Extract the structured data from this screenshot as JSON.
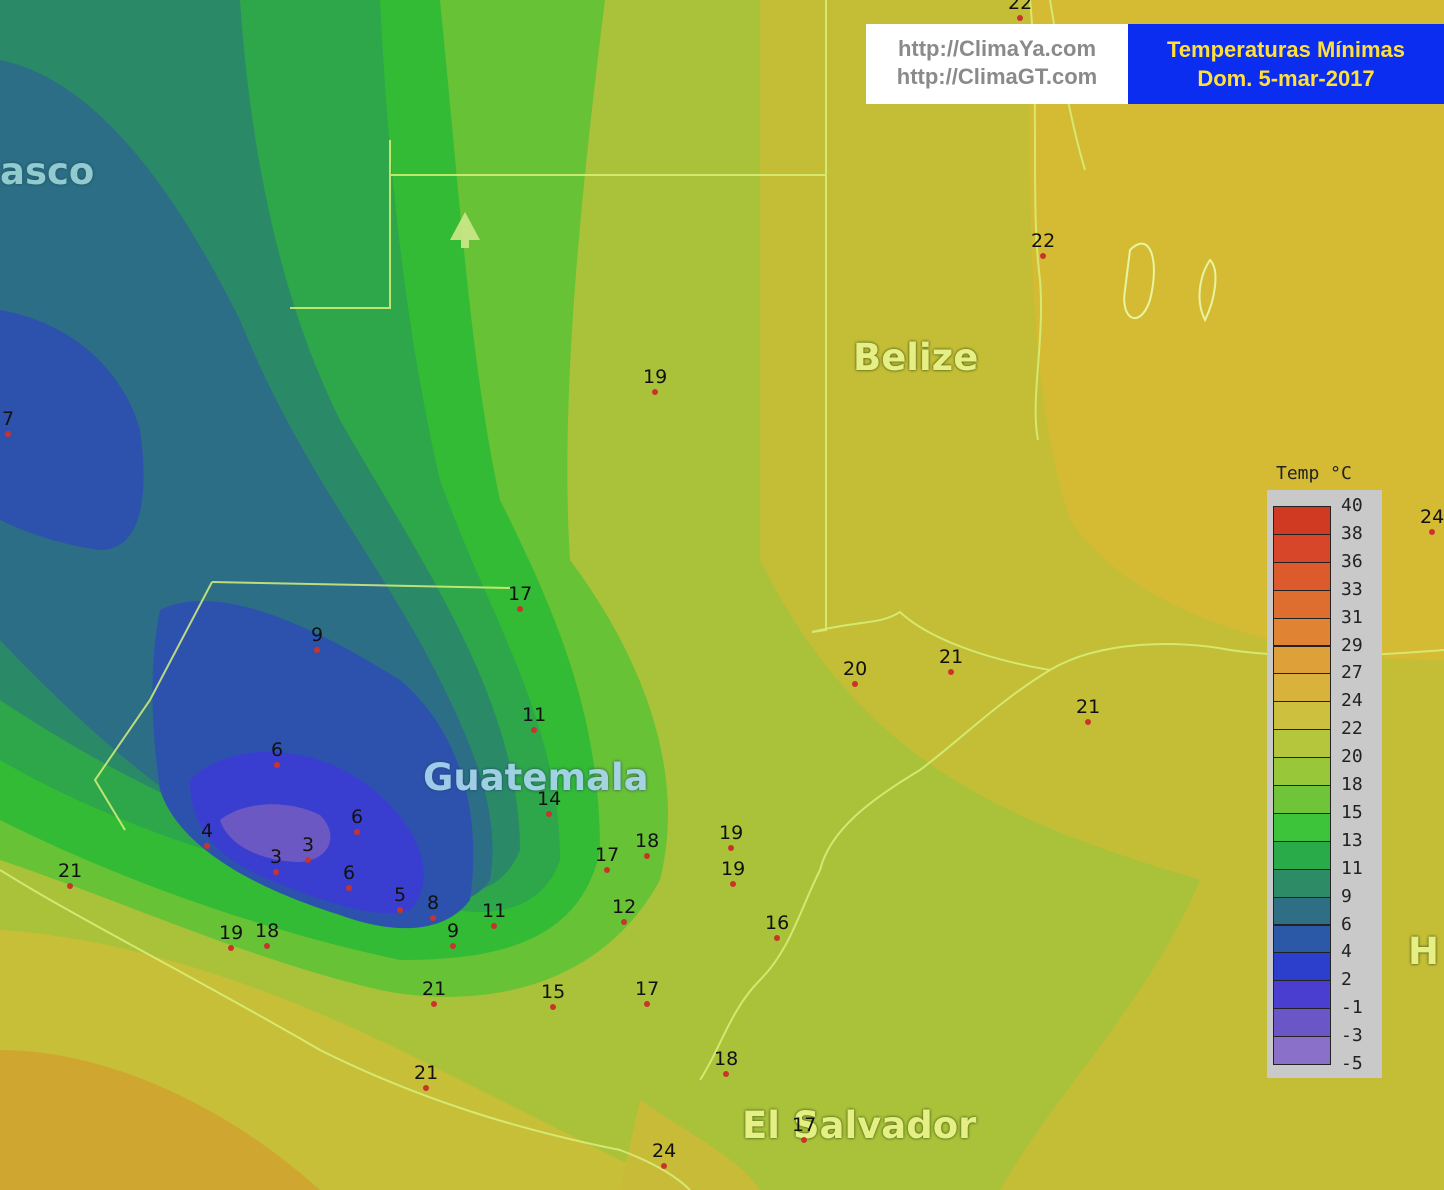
{
  "header": {
    "urls": [
      "http://ClimaYa.com",
      "http://ClimaGT.com"
    ],
    "title": "Temperaturas Mínimas",
    "date": "Dom. 5-mar-2017"
  },
  "countries": {
    "tabasco": "asco",
    "belize": "Belize",
    "guatemala": "Guatemala",
    "el_salvador": "El Salvador",
    "honduras": "H"
  },
  "stations": [
    "7",
    "9",
    "17",
    "11",
    "6",
    "4",
    "3",
    "3",
    "6",
    "6",
    "5",
    "8",
    "9",
    "11",
    "14",
    "12",
    "17",
    "18",
    "19",
    "19",
    "16",
    "17",
    "15",
    "21",
    "21",
    "19",
    "18",
    "21",
    "19",
    "20",
    "21",
    "21",
    "22",
    "22",
    "24",
    "18",
    "17",
    "24"
  ],
  "legend": {
    "title": "Temp °C",
    "labels": [
      "40",
      "38",
      "36",
      "33",
      "31",
      "29",
      "27",
      "24",
      "22",
      "20",
      "18",
      "15",
      "13",
      "11",
      "9",
      "6",
      "4",
      "2",
      "-1",
      "-3",
      "-5"
    ],
    "colors": [
      "#d03a22",
      "#d8462a",
      "#dc5a2c",
      "#de6e30",
      "#e08434",
      "#dea038",
      "#d8b23c",
      "#ccc03e",
      "#b6c63c",
      "#98c83a",
      "#70c43a",
      "#3ec43a",
      "#2aab4a",
      "#2d8c66",
      "#2e6f84",
      "#2c58a8",
      "#2c3fcc",
      "#4a3ed0",
      "#6a56c6",
      "#8a70c8",
      "#a98ed4"
    ]
  }
}
